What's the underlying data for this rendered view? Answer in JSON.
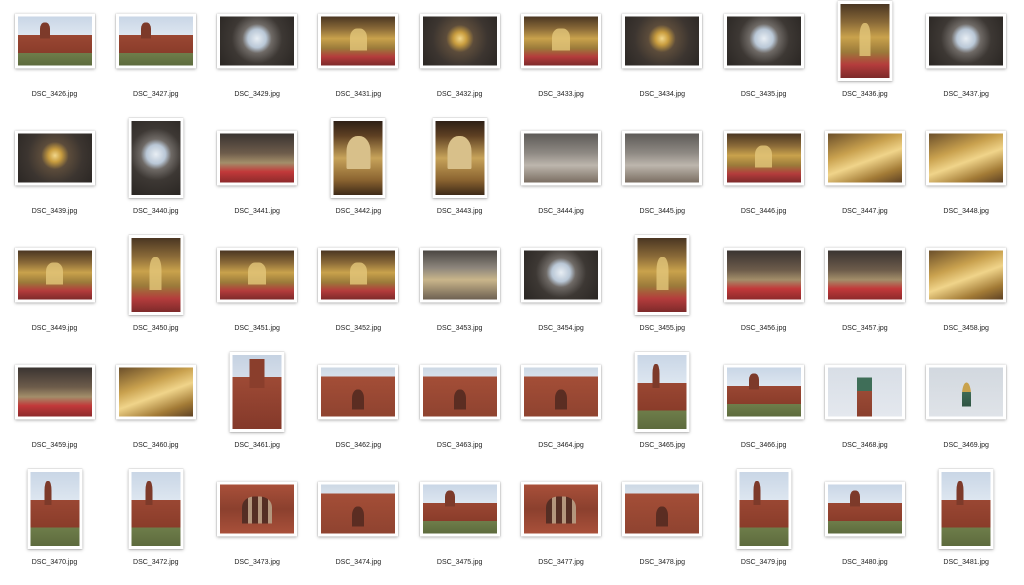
{
  "files": [
    {
      "name": "DSC_3426.jpg",
      "orientation": "landscape",
      "scene": "exterior"
    },
    {
      "name": "DSC_3427.jpg",
      "orientation": "landscape",
      "scene": "exterior"
    },
    {
      "name": "DSC_3429.jpg",
      "orientation": "landscape",
      "scene": "dome"
    },
    {
      "name": "DSC_3431.jpg",
      "orientation": "landscape",
      "scene": "iconostasis"
    },
    {
      "name": "DSC_3432.jpg",
      "orientation": "landscape",
      "scene": "chandelier"
    },
    {
      "name": "DSC_3433.jpg",
      "orientation": "landscape",
      "scene": "iconostasis"
    },
    {
      "name": "DSC_3434.jpg",
      "orientation": "landscape",
      "scene": "chandelier"
    },
    {
      "name": "DSC_3435.jpg",
      "orientation": "landscape",
      "scene": "dome"
    },
    {
      "name": "DSC_3436.jpg",
      "orientation": "portrait",
      "scene": "iconostasis"
    },
    {
      "name": "DSC_3437.jpg",
      "orientation": "landscape",
      "scene": "dome"
    },
    {
      "name": "DSC_3439.jpg",
      "orientation": "landscape",
      "scene": "chandelier"
    },
    {
      "name": "DSC_3440.jpg",
      "orientation": "portrait",
      "scene": "dome"
    },
    {
      "name": "DSC_3441.jpg",
      "orientation": "landscape",
      "scene": "nave"
    },
    {
      "name": "DSC_3442.jpg",
      "orientation": "portrait",
      "scene": "icon"
    },
    {
      "name": "DSC_3443.jpg",
      "orientation": "portrait",
      "scene": "icon"
    },
    {
      "name": "DSC_3444.jpg",
      "orientation": "landscape",
      "scene": "chapel"
    },
    {
      "name": "DSC_3445.jpg",
      "orientation": "landscape",
      "scene": "chapel"
    },
    {
      "name": "DSC_3446.jpg",
      "orientation": "landscape",
      "scene": "iconostasis"
    },
    {
      "name": "DSC_3447.jpg",
      "orientation": "landscape",
      "scene": "gold"
    },
    {
      "name": "DSC_3448.jpg",
      "orientation": "landscape",
      "scene": "gold"
    },
    {
      "name": "DSC_3449.jpg",
      "orientation": "landscape",
      "scene": "iconostasis"
    },
    {
      "name": "DSC_3450.jpg",
      "orientation": "portrait",
      "scene": "iconostasis"
    },
    {
      "name": "DSC_3451.jpg",
      "orientation": "landscape",
      "scene": "iconostasis"
    },
    {
      "name": "DSC_3452.jpg",
      "orientation": "landscape",
      "scene": "iconostasis"
    },
    {
      "name": "DSC_3453.jpg",
      "orientation": "landscape",
      "scene": "ceiling"
    },
    {
      "name": "DSC_3454.jpg",
      "orientation": "landscape",
      "scene": "dome"
    },
    {
      "name": "DSC_3455.jpg",
      "orientation": "portrait",
      "scene": "iconostasis"
    },
    {
      "name": "DSC_3456.jpg",
      "orientation": "landscape",
      "scene": "nave"
    },
    {
      "name": "DSC_3457.jpg",
      "orientation": "landscape",
      "scene": "nave"
    },
    {
      "name": "DSC_3458.jpg",
      "orientation": "landscape",
      "scene": "gold"
    },
    {
      "name": "DSC_3459.jpg",
      "orientation": "landscape",
      "scene": "nave"
    },
    {
      "name": "DSC_3460.jpg",
      "orientation": "landscape",
      "scene": "gold"
    },
    {
      "name": "DSC_3461.jpg",
      "orientation": "portrait",
      "scene": "tower"
    },
    {
      "name": "DSC_3462.jpg",
      "orientation": "landscape",
      "scene": "facade"
    },
    {
      "name": "DSC_3463.jpg",
      "orientation": "landscape",
      "scene": "facade"
    },
    {
      "name": "DSC_3464.jpg",
      "orientation": "landscape",
      "scene": "facade"
    },
    {
      "name": "DSC_3465.jpg",
      "orientation": "portrait",
      "scene": "exterior"
    },
    {
      "name": "DSC_3466.jpg",
      "orientation": "landscape",
      "scene": "exterior"
    },
    {
      "name": "DSC_3468.jpg",
      "orientation": "landscape",
      "scene": "spire"
    },
    {
      "name": "DSC_3469.jpg",
      "orientation": "landscape",
      "scene": "cupola"
    },
    {
      "name": "DSC_3470.jpg",
      "orientation": "portrait",
      "scene": "exterior"
    },
    {
      "name": "DSC_3472.jpg",
      "orientation": "portrait",
      "scene": "exterior"
    },
    {
      "name": "DSC_3473.jpg",
      "orientation": "landscape",
      "scene": "detail"
    },
    {
      "name": "DSC_3474.jpg",
      "orientation": "landscape",
      "scene": "facade"
    },
    {
      "name": "DSC_3475.jpg",
      "orientation": "landscape",
      "scene": "exterior"
    },
    {
      "name": "DSC_3477.jpg",
      "orientation": "landscape",
      "scene": "detail"
    },
    {
      "name": "DSC_3478.jpg",
      "orientation": "landscape",
      "scene": "facade"
    },
    {
      "name": "DSC_3479.jpg",
      "orientation": "portrait",
      "scene": "exterior"
    },
    {
      "name": "DSC_3480.jpg",
      "orientation": "landscape",
      "scene": "exterior"
    },
    {
      "name": "DSC_3481.jpg",
      "orientation": "portrait",
      "scene": "exterior"
    }
  ]
}
